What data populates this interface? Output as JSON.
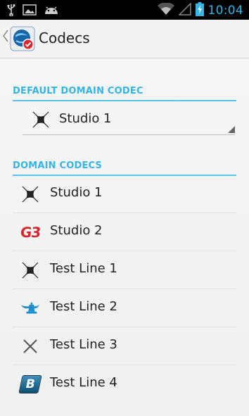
{
  "status_bar": {
    "time": "10:04",
    "icons": [
      "usb-icon",
      "image-icon",
      "android-icon",
      "wifi-icon",
      "signal-icon",
      "battery-charging-icon"
    ]
  },
  "action_bar": {
    "title": "Codecs",
    "back_icon": "chevron-left-icon",
    "app_icon": "app-logo-icon"
  },
  "default_section": {
    "header": "DEFAULT DOMAIN CODEC",
    "selected": {
      "label": "Studio 1",
      "icon": "codec-x-icon"
    }
  },
  "domain_section": {
    "header": "DOMAIN CODECS",
    "items": [
      {
        "label": "Studio 1",
        "icon": "codec-x-icon"
      },
      {
        "label": "Studio 2",
        "icon": "g3-icon",
        "icon_text": "G3"
      },
      {
        "label": "Test Line 1",
        "icon": "codec-x-icon"
      },
      {
        "label": "Test Line 2",
        "icon": "genie-lamp-icon"
      },
      {
        "label": "Test Line 3",
        "icon": "thin-x-icon"
      },
      {
        "label": "Test Line 4",
        "icon": "b-badge-icon",
        "icon_text": "B"
      }
    ]
  },
  "colors": {
    "accent": "#33b5e5",
    "g3_red": "#d8262c",
    "lamp_blue": "#1a8fd0"
  }
}
